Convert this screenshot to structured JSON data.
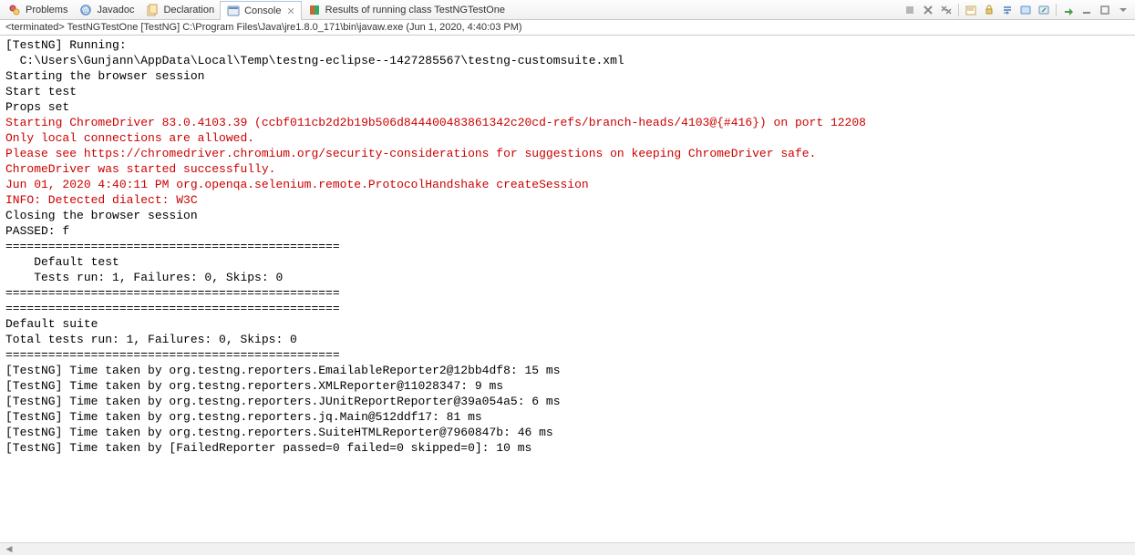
{
  "tabs": [
    {
      "label": "Problems"
    },
    {
      "label": "Javadoc"
    },
    {
      "label": "Declaration"
    },
    {
      "label": "Console"
    },
    {
      "label": "Results of running class TestNGTestOne"
    }
  ],
  "status": "<terminated> TestNGTestOne [TestNG] C:\\Program Files\\Java\\jre1.8.0_171\\bin\\javaw.exe (Jun 1, 2020, 4:40:03 PM)",
  "lines": {
    "l0": "[TestNG] Running:",
    "l1": "  C:\\Users\\Gunjann\\AppData\\Local\\Temp\\testng-eclipse--1427285567\\testng-customsuite.xml",
    "l2": "",
    "l3": "Starting the browser session",
    "l4": "Start test",
    "l5": "Props set",
    "l6": "Starting ChromeDriver 83.0.4103.39 (ccbf011cb2d2b19b506d844400483861342c20cd-refs/branch-heads/4103@{#416}) on port 12208",
    "l7": "Only local connections are allowed.",
    "l8": "Please see https://chromedriver.chromium.org/security-considerations for suggestions on keeping ChromeDriver safe.",
    "l9": "ChromeDriver was started successfully.",
    "l10": "Jun 01, 2020 4:40:11 PM org.openqa.selenium.remote.ProtocolHandshake createSession",
    "l11": "INFO: Detected dialect: W3C",
    "l12": "Closing the browser session",
    "l13": "PASSED: f",
    "l14": "",
    "l15": "===============================================",
    "l16": "    Default test",
    "l17": "    Tests run: 1, Failures: 0, Skips: 0",
    "l18": "===============================================",
    "l19": "",
    "l20": "",
    "l21": "===============================================",
    "l22": "Default suite",
    "l23": "Total tests run: 1, Failures: 0, Skips: 0",
    "l24": "===============================================",
    "l25": "",
    "l26": "",
    "l27": "[TestNG] Time taken by org.testng.reporters.EmailableReporter2@12bb4df8: 15 ms",
    "l28": "[TestNG] Time taken by org.testng.reporters.XMLReporter@11028347: 9 ms",
    "l29": "[TestNG] Time taken by org.testng.reporters.JUnitReportReporter@39a054a5: 6 ms",
    "l30": "[TestNG] Time taken by org.testng.reporters.jq.Main@512ddf17: 81 ms",
    "l31": "[TestNG] Time taken by org.testng.reporters.SuiteHTMLReporter@7960847b: 46 ms",
    "l32": "[TestNG] Time taken by [FailedReporter passed=0 failed=0 skipped=0]: 10 ms"
  }
}
